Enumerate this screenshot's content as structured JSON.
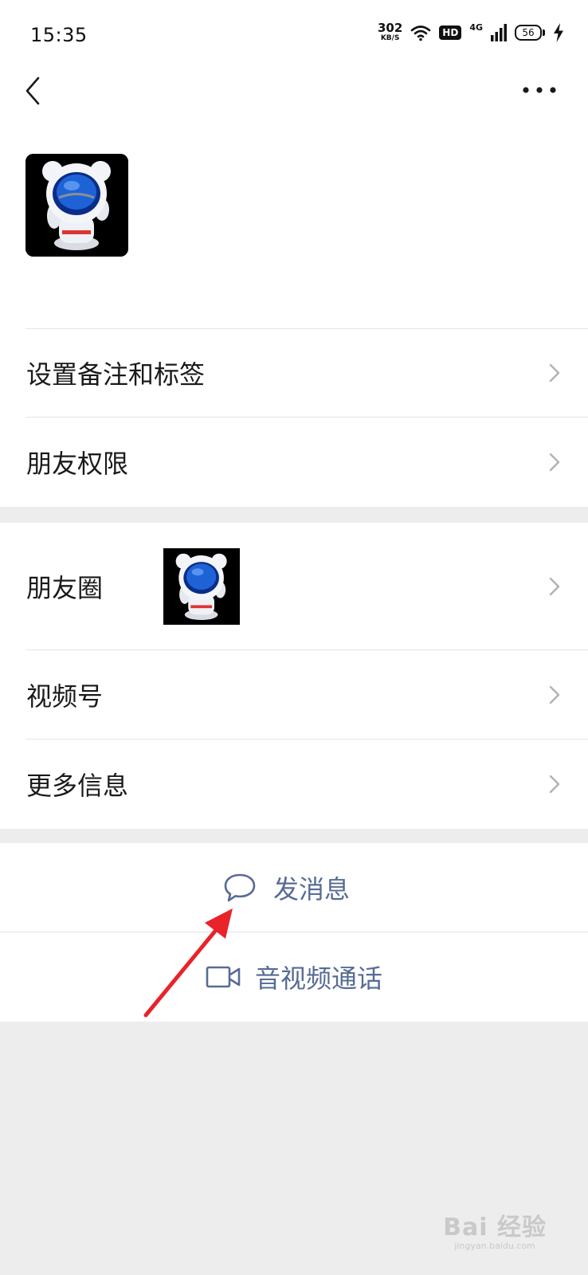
{
  "status_bar": {
    "time": "15:35",
    "net_speed": "302",
    "net_speed_unit": "KB/S",
    "hd": "HD",
    "network": "4G",
    "battery": "56"
  },
  "profile": {
    "avatar": "astronaut-avatar"
  },
  "settings_section": {
    "items": [
      {
        "label": "设置备注和标签"
      },
      {
        "label": "朋友权限"
      }
    ]
  },
  "info_section": {
    "items": [
      {
        "label": "朋友圈"
      },
      {
        "label": "视频号"
      },
      {
        "label": "更多信息"
      }
    ]
  },
  "actions": {
    "send_message": "发消息",
    "av_call": "音视频通话"
  },
  "watermark": {
    "main": "Bai 经验",
    "sub": "jingyan.baidu.com"
  },
  "colors": {
    "accent_link": "#576b95",
    "annotation_arrow": "#e8232a",
    "page_bg": "#ededed"
  }
}
